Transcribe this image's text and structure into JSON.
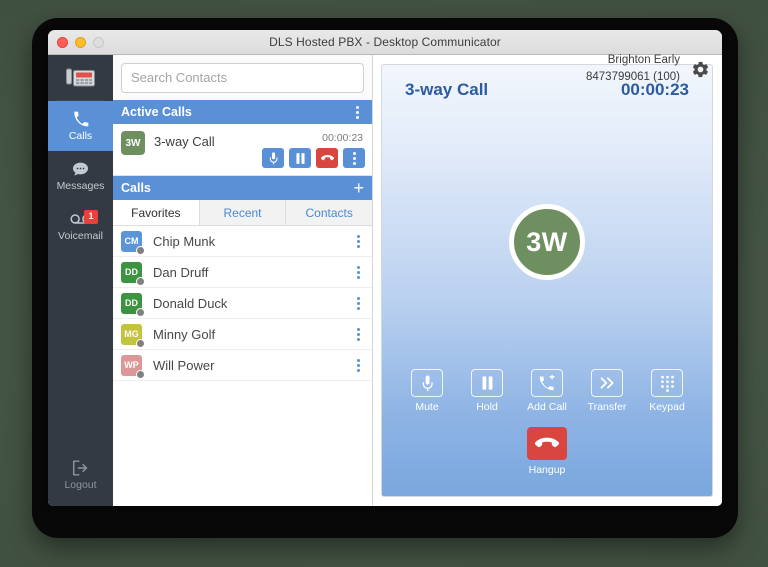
{
  "window": {
    "title": "DLS Hosted PBX - Desktop Communicator",
    "traffic": {
      "close": "close-button",
      "minimize": "minimize-button",
      "maximize": "maximize-button"
    }
  },
  "header": {
    "search_placeholder": "Search Contacts",
    "search_value": "",
    "user_name": "Brighton Early",
    "user_number": "8473799061 (100)",
    "settings_icon": "gear-icon"
  },
  "rail": {
    "logo_icon": "desk-phone-icon",
    "items": [
      {
        "label": "Calls",
        "icon": "phone-handset-icon",
        "active": true,
        "badge": ""
      },
      {
        "label": "Messages",
        "icon": "chat-bubble-icon",
        "active": false,
        "badge": ""
      },
      {
        "label": "Voicemail",
        "icon": "voicemail-tape-icon",
        "active": false,
        "badge": "1"
      }
    ],
    "logout": {
      "label": "Logout",
      "icon": "logout-arrow-icon"
    }
  },
  "active_calls": {
    "header": "Active Calls",
    "menu_icon": "kebab-menu-icon",
    "call": {
      "initials": "3W",
      "avatar_color": "#6e8f5f",
      "name": "3-way Call",
      "timer": "00:00:23",
      "actions": [
        {
          "name": "mute-button",
          "icon": "microphone-icon",
          "style": "primary"
        },
        {
          "name": "hold-button",
          "icon": "pause-icon",
          "style": "primary"
        },
        {
          "name": "hangup-button",
          "icon": "hangup-phone-icon",
          "style": "danger"
        },
        {
          "name": "more-button",
          "icon": "kebab-menu-icon",
          "style": "primary"
        }
      ]
    }
  },
  "calls_section": {
    "header": "Calls",
    "add_label": "+",
    "tabs": [
      {
        "label": "Favorites",
        "active": true
      },
      {
        "label": "Recent",
        "active": false
      },
      {
        "label": "Contacts",
        "active": false
      }
    ],
    "contacts": [
      {
        "initials": "CM",
        "name": "Chip Munk",
        "color": "#5b95d8",
        "presence": "#808080"
      },
      {
        "initials": "DD",
        "name": "Dan Druff",
        "color": "#3d9440",
        "presence": "#808080"
      },
      {
        "initials": "DD",
        "name": "Donald Duck",
        "color": "#3d9440",
        "presence": "#808080"
      },
      {
        "initials": "MG",
        "name": "Minny Golf",
        "color": "#c3c33f",
        "presence": "#808080"
      },
      {
        "initials": "WP",
        "name": "Will Power",
        "color": "#dc9797",
        "presence": "#808080"
      }
    ]
  },
  "call_panel": {
    "title": "3-way Call",
    "timer": "00:00:23",
    "avatar_initials": "3W",
    "avatar_color": "#6e8f5f",
    "controls": [
      {
        "label": "Mute",
        "icon": "microphone-icon"
      },
      {
        "label": "Hold",
        "icon": "pause-icon"
      },
      {
        "label": "Add Call",
        "icon": "phone-plus-icon"
      },
      {
        "label": "Transfer",
        "icon": "double-chevron-right-icon"
      },
      {
        "label": "Keypad",
        "icon": "dialpad-grid-icon"
      }
    ],
    "hangup": {
      "label": "Hangup",
      "icon": "hangup-phone-icon",
      "color": "#d9453f"
    }
  },
  "colors": {
    "accent_blue": "#5a90d6",
    "danger_red": "#d9453f",
    "rail_dark": "#343a43",
    "panel_gradient_top": "#f2f6fc",
    "panel_gradient_bottom": "#7aa7de"
  }
}
